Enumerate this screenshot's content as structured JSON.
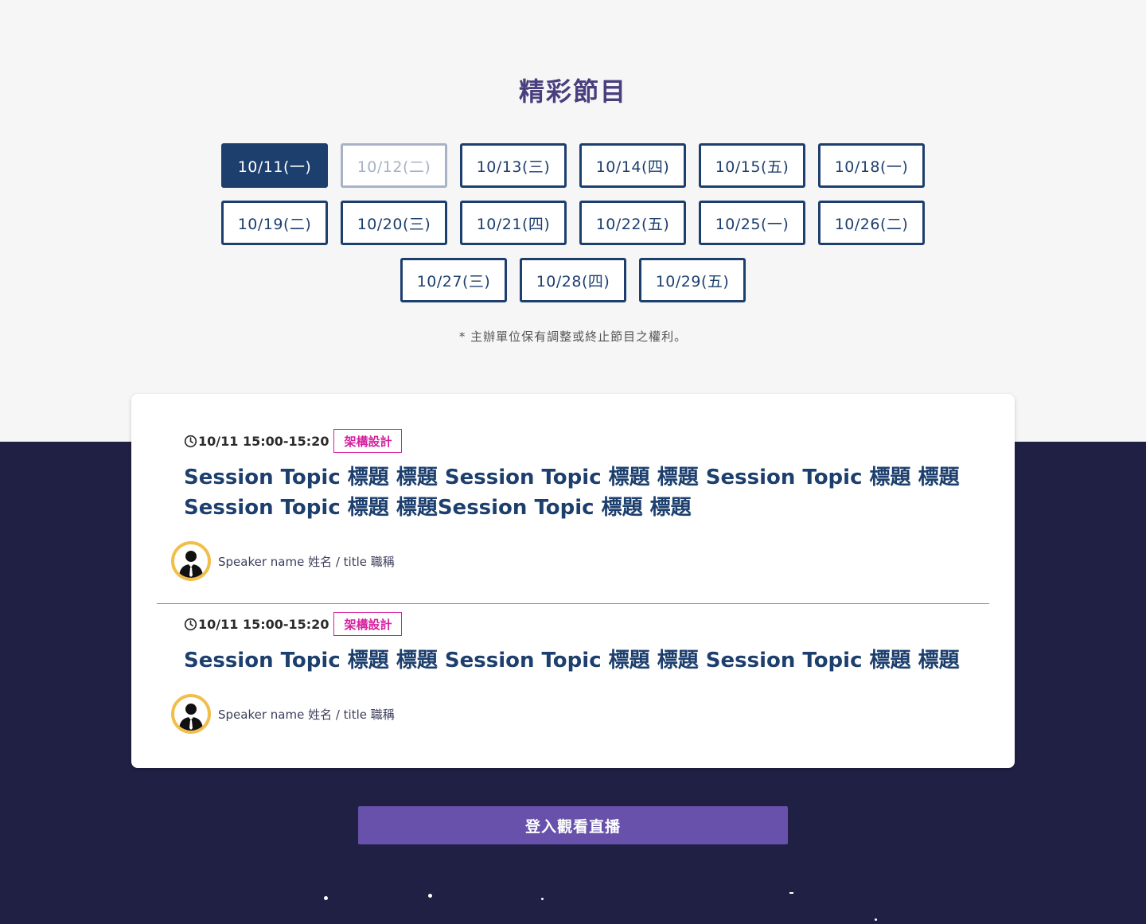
{
  "section": {
    "title": "精彩節目"
  },
  "dates": [
    {
      "label": "10/11(一)",
      "state": "active"
    },
    {
      "label": "10/12(二)",
      "state": "disabled"
    },
    {
      "label": "10/13(三)",
      "state": "normal"
    },
    {
      "label": "10/14(四)",
      "state": "normal"
    },
    {
      "label": "10/15(五)",
      "state": "normal"
    },
    {
      "label": "10/18(一)",
      "state": "normal"
    },
    {
      "label": "10/19(二)",
      "state": "normal"
    },
    {
      "label": "10/20(三)",
      "state": "normal"
    },
    {
      "label": "10/21(四)",
      "state": "normal"
    },
    {
      "label": "10/22(五)",
      "state": "normal"
    },
    {
      "label": "10/25(一)",
      "state": "normal"
    },
    {
      "label": "10/26(二)",
      "state": "normal"
    },
    {
      "label": "10/27(三)",
      "state": "normal"
    },
    {
      "label": "10/28(四)",
      "state": "normal"
    },
    {
      "label": "10/29(五)",
      "state": "normal"
    }
  ],
  "note": "* 主辦單位保有調整或終止節目之權利。",
  "sessions": [
    {
      "time": "10/11 15:00-15:20",
      "tag": "架構設計",
      "topic": "Session Topic 標題 標題 Session Topic 標題 標題 Session Topic 標題 標題 Session Topic 標題 標題Session Topic 標題 標題",
      "speaker": "Speaker name 姓名 / title 職稱"
    },
    {
      "time": "10/11 15:00-15:20",
      "tag": "架構設計",
      "topic": "Session Topic 標題 標題 Session Topic 標題 標題 Session Topic 標題 標題",
      "speaker": "Speaker name 姓名 / title 職稱"
    }
  ],
  "login_button": "登入觀看直播",
  "colors": {
    "primary": "#1d3f6e",
    "accent_tag": "#d61f9e",
    "button": "#6751ab",
    "dark_bg": "#1f2044",
    "avatar_ring": "#f2be4b"
  },
  "icons": [
    "clock-icon",
    "speaker-avatar-icon"
  ]
}
